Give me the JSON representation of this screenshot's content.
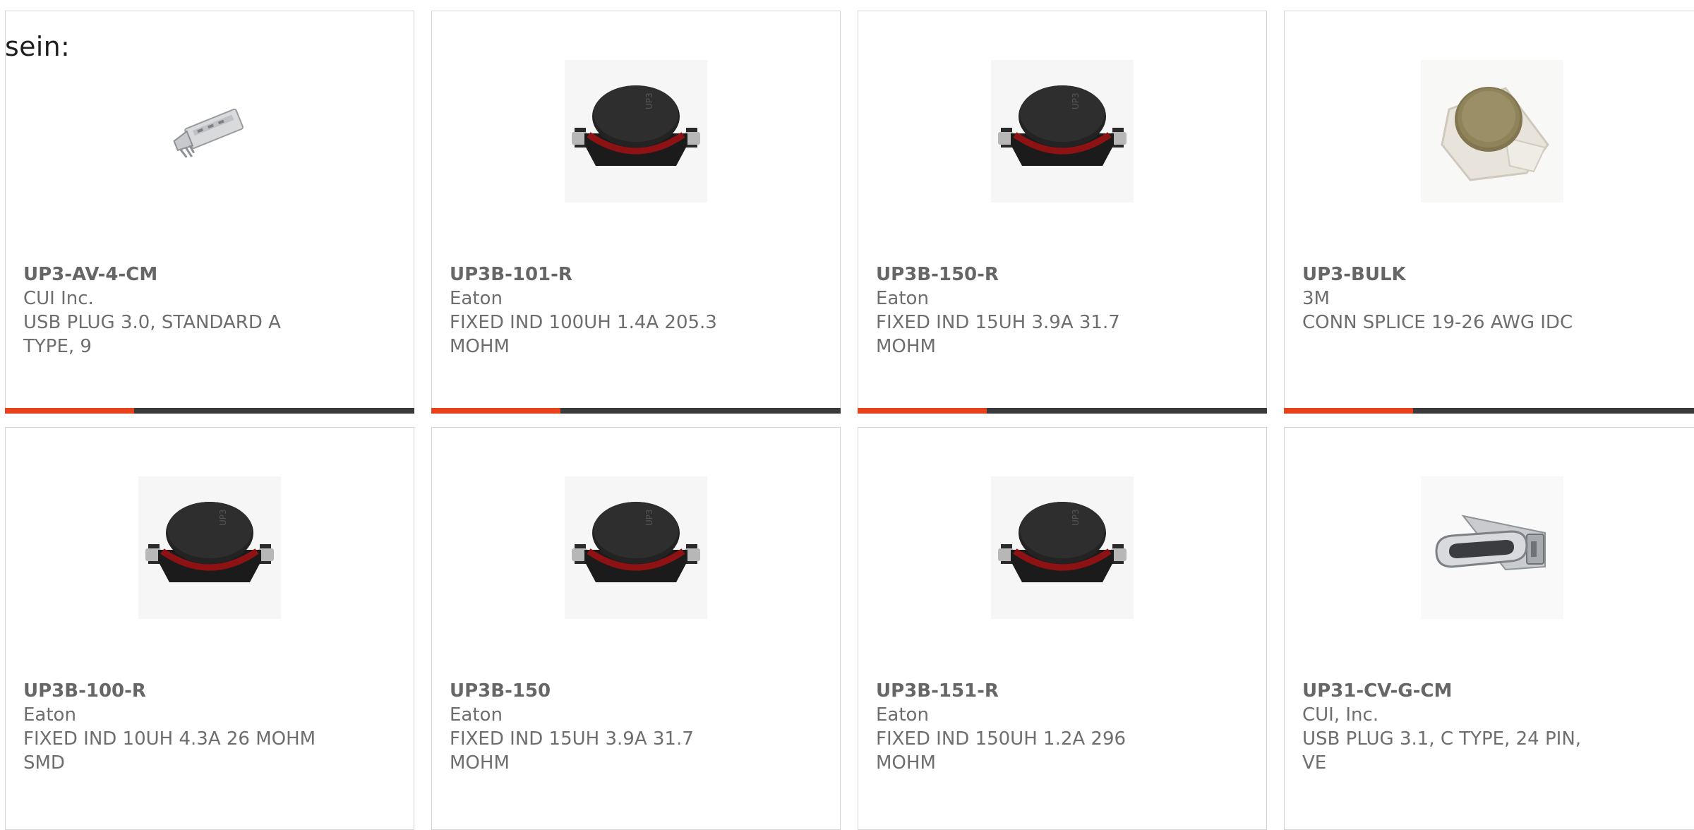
{
  "intro": "sein:",
  "colors": {
    "accent": "#e8421b",
    "bar_track": "#3a3a3a",
    "border": "#d4d4d4"
  },
  "products": [
    {
      "part_number": "UP3-AV-4-CM",
      "manufacturer": "CUI Inc.",
      "description": "USB PLUG 3.0, STANDARD A TYPE, 9",
      "image": "usb-a-plug-icon"
    },
    {
      "part_number": "UP3B-101-R",
      "manufacturer": "Eaton",
      "description": "FIXED IND 100UH 1.4A 205.3 MOHM",
      "image": "inductor-icon"
    },
    {
      "part_number": "UP3B-150-R",
      "manufacturer": "Eaton",
      "description": "FIXED IND 15UH 3.9A 31.7 MOHM",
      "image": "inductor-icon"
    },
    {
      "part_number": "UP3-BULK",
      "manufacturer": "3M",
      "description": "CONN SPLICE 19-26 AWG IDC",
      "image": "splice-connector-icon"
    },
    {
      "part_number": "UP3B-100-R",
      "manufacturer": "Eaton",
      "description": "FIXED IND 10UH 4.3A 26 MOHM SMD",
      "image": "inductor-icon"
    },
    {
      "part_number": "UP3B-150",
      "manufacturer": "Eaton",
      "description": "FIXED IND 15UH 3.9A 31.7 MOHM",
      "image": "inductor-icon"
    },
    {
      "part_number": "UP3B-151-R",
      "manufacturer": "Eaton",
      "description": "FIXED IND 150UH 1.2A 296 MOHM",
      "image": "inductor-icon"
    },
    {
      "part_number": "UP31-CV-G-CM",
      "manufacturer": "CUI, Inc.",
      "description": "USB PLUG 3.1, C TYPE, 24 PIN, VE",
      "image": "usb-c-plug-icon"
    }
  ]
}
